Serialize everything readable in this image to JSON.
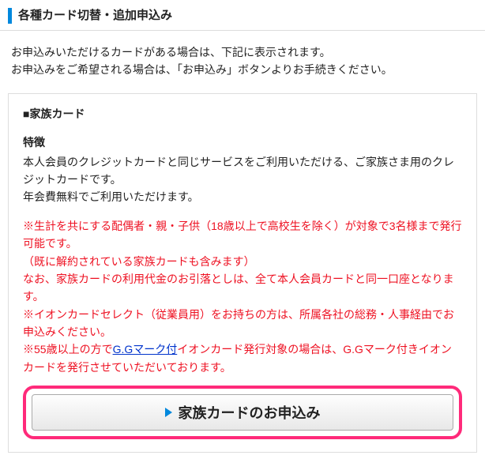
{
  "page": {
    "title": "各種カード切替・追加申込み"
  },
  "intro": {
    "line1": "お申込みいただけるカードがある場合は、下記に表示されます。",
    "line2": "お申込みをご希望される場合は、「お申込み」ボタンよりお手続きください。"
  },
  "card": {
    "panel_title": "■家族カード",
    "features_label": "特徴",
    "features_line1": "本人会員のクレジットカードと同じサービスをご利用いただける、ご家族さま用のクレジットカードです。",
    "features_line2": "年会費無料でご利用いただけます。",
    "notes": {
      "n1": "※生計を共にする配偶者・親・子供（18歳以上で高校生を除く）が対象で3名様まで発行可能です。",
      "n2": "（既に解約されている家族カードも含みます）",
      "n3": "なお、家族カードの利用代金のお引落としは、全て本人会員カードと同一口座となります。",
      "n4": "※イオンカードセレクト（従業員用）をお持ちの方は、所属各社の総務・人事経由でお申込みください。",
      "n5_prefix": "※55歳以上の方で",
      "n5_link": "G.Gマーク付",
      "n5_suffix": "イオンカード発行対象の場合は、G.Gマーク付きイオンカードを発行させていただいております。"
    },
    "apply_button_label": "家族カードのお申込み"
  }
}
